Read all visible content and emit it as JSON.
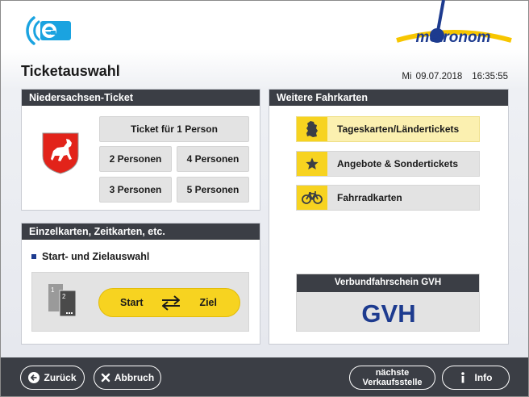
{
  "header": {
    "title": "Ticketauswahl",
    "date": "Mi 09.07.2018",
    "time": "16:35:55",
    "brand_logo_text": "metronom"
  },
  "panel_niedersachsen": {
    "title": "Niedersachsen-Ticket",
    "buttons": {
      "one_person": "Ticket für 1 Person",
      "two_persons": "2 Personen",
      "three_persons": "3 Personen",
      "four_persons": "4 Personen",
      "five_persons": "5 Personen"
    }
  },
  "panel_einzel": {
    "title": "Einzelkarten, Zeitkarten, etc.",
    "section_title": "Start- und Zielauswahl",
    "start_label": "Start",
    "ziel_label": "Ziel",
    "ticket_icon_numbers": [
      "1",
      "2"
    ]
  },
  "panel_weitere": {
    "title": "Weitere Fahrkarten",
    "items": [
      {
        "label": "Tageskarten/Ländertickets",
        "icon": "germany-map-icon",
        "active": true
      },
      {
        "label": "Angebote & Sondertickets",
        "icon": "star-icon",
        "active": false
      },
      {
        "label": "Fahrradkarten",
        "icon": "bicycle-icon",
        "active": false
      }
    ],
    "gvh": {
      "title": "Verbundfahrschein GVH",
      "logo_text": "GVH"
    }
  },
  "footer": {
    "back": "Zurück",
    "cancel": "Abbruch",
    "next_sales_line1": "nächste",
    "next_sales_line2": "Verkaufsstelle",
    "info": "Info"
  },
  "colors": {
    "accent_yellow": "#f7d320",
    "dark_header": "#3b3e45",
    "brand_blue": "#1d3b8f",
    "button_gray": "#e3e3e3"
  }
}
